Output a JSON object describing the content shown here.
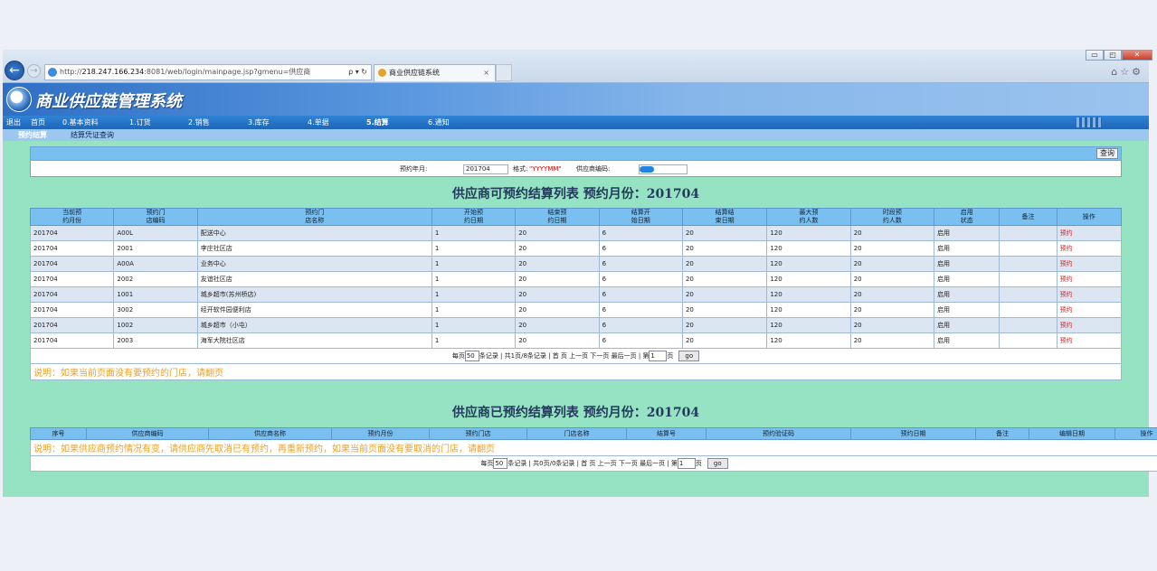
{
  "browser": {
    "url_prefix": "http://",
    "url_host": "218.247.166.234",
    "url_rest": ":8081/web/login/mainpage.jsp?gmenu=供应商",
    "url_tools": "ρ ▾ ↻",
    "tab_title": "商业供应链系统",
    "tab_close": "×",
    "window_controls": [
      "▭",
      "◰",
      "✕"
    ],
    "right_tools": "⌂☆⚙"
  },
  "app": {
    "title": "商业供应链管理系统",
    "menu": [
      "退出",
      "首页",
      "0.基本资料",
      "1.订货",
      "2.销售",
      "3.库存",
      "4.单据",
      "5.结算",
      "6.通知"
    ],
    "menu_active": "5.结算",
    "submenu": [
      "预约结算",
      "结算凭证查询"
    ],
    "submenu_active": "预约结算"
  },
  "query": {
    "button": "查询",
    "label_month": "预约年月:",
    "value_month": "201704",
    "format_label": "格式:",
    "format_value": "\"YYYYMM\"",
    "label_supplier": "供应商编码:"
  },
  "table1": {
    "title": "供应商可预约结算列表  预约月份：201704",
    "headers": [
      "当前预约月份",
      "预约门店编码",
      "预约门店名称",
      "开始预约日期",
      "结束预约日期",
      "结算开始日期",
      "结算结束日期",
      "最大预约人数",
      "时段预约人数",
      "启用状态",
      "备注",
      "操作"
    ],
    "header_lines": [
      [
        "当前预",
        "约月份"
      ],
      [
        "预约门",
        "店编码"
      ],
      [
        "预约门",
        "店名称"
      ],
      [
        "开始预",
        "约日期"
      ],
      [
        "结束预",
        "约日期"
      ],
      [
        "结算开",
        "始日期"
      ],
      [
        "结算结",
        "束日期"
      ],
      [
        "最大预",
        "约人数"
      ],
      [
        "时段预",
        "约人数"
      ],
      [
        "启用",
        "状态"
      ],
      [
        "备注",
        ""
      ],
      [
        "操作",
        ""
      ]
    ],
    "rows": [
      [
        "201704",
        "A00L",
        "配送中心",
        "1",
        "20",
        "6",
        "20",
        "120",
        "20",
        "启用",
        "",
        "预约"
      ],
      [
        "201704",
        "2001",
        "李庄社区店",
        "1",
        "20",
        "6",
        "20",
        "120",
        "20",
        "启用",
        "",
        "预约"
      ],
      [
        "201704",
        "A00A",
        "业务中心",
        "1",
        "20",
        "6",
        "20",
        "120",
        "20",
        "启用",
        "",
        "预约"
      ],
      [
        "201704",
        "2002",
        "友谊社区店",
        "1",
        "20",
        "6",
        "20",
        "120",
        "20",
        "启用",
        "",
        "预约"
      ],
      [
        "201704",
        "1001",
        "城乡超市(苏州桥店)",
        "1",
        "20",
        "6",
        "20",
        "120",
        "20",
        "启用",
        "",
        "预约"
      ],
      [
        "201704",
        "3002",
        "经开软件园便利店",
        "1",
        "20",
        "6",
        "20",
        "120",
        "20",
        "启用",
        "",
        "预约"
      ],
      [
        "201704",
        "1002",
        "城乡超市（小屯）",
        "1",
        "20",
        "6",
        "20",
        "120",
        "20",
        "启用",
        "",
        "预约"
      ],
      [
        "201704",
        "2003",
        "海军大院社区店",
        "1",
        "20",
        "6",
        "20",
        "120",
        "20",
        "启用",
        "",
        "预约"
      ]
    ],
    "pager": {
      "per_page_prefix": "每页",
      "per_page": "50",
      "per_page_suffix": "条记录 | 共1页/8条记录 | 首 页 上一页 下一页 最后一页 | 第",
      "page": "1",
      "page_suffix": "页",
      "go": "go"
    },
    "note": "说明：如果当前页面没有要预约的门店，请翻页"
  },
  "table2": {
    "title": "供应商已预约结算列表  预约月份：201704",
    "headers": [
      "序号",
      "供应商编码",
      "供应商名称",
      "预约月份",
      "预约门店",
      "门店名称",
      "结算号",
      "预约验证码",
      "预约日期",
      "备注",
      "编辑日期",
      "操作"
    ],
    "note": "说明：如果供应商预约情况有变，请供应商先取消已有预约，再重新预约，如果当前页面没有要取消的门店，请翻页",
    "pager": {
      "per_page_prefix": "每页",
      "per_page": "50",
      "per_page_suffix": "条记录 | 共0页/0条记录 | 首 页 上一页 下一页 最后一页 | 第",
      "page": "1",
      "page_suffix": "页",
      "go": "go"
    }
  },
  "colors": {
    "content_bg": "#96e3c3",
    "header_blue": "#79bff0",
    "menu_blue": "#1d66b8",
    "action_red": "#e02020",
    "note_orange": "#f0a020"
  }
}
